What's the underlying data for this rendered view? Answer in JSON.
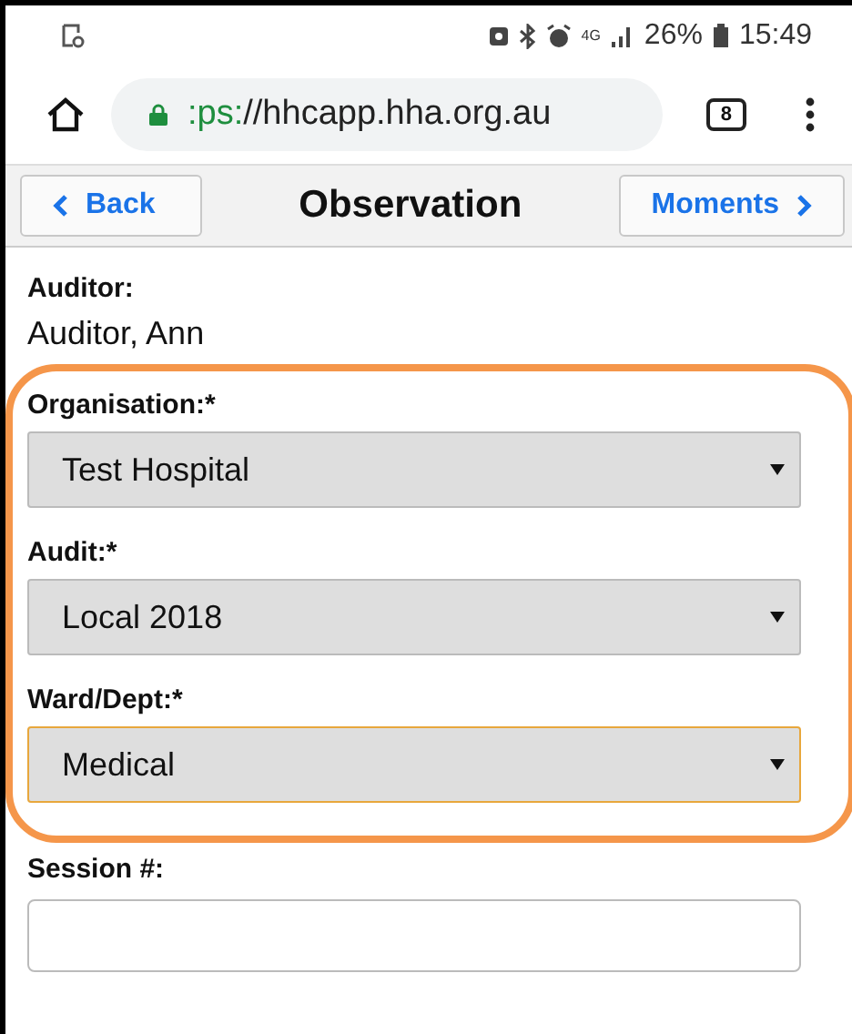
{
  "status_bar": {
    "battery": "26%",
    "time": "15:49",
    "network": "4G"
  },
  "browser": {
    "url_scheme": ":ps:",
    "url_rest": "//hhcapp.hha.org.au",
    "tab_count": "8"
  },
  "header": {
    "back": "Back",
    "title": "Observation",
    "next": "Moments"
  },
  "auditor": {
    "label": "Auditor:",
    "value": "Auditor, Ann"
  },
  "highlight_outline": true,
  "selects": [
    {
      "label": "Organisation:*",
      "value": "Test Hospital",
      "focused": false
    },
    {
      "label": "Audit:*",
      "value": "Local 2018",
      "focused": false
    },
    {
      "label": "Ward/Dept:*",
      "value": "Medical",
      "focused": true
    }
  ],
  "session": {
    "label": "Session #:"
  }
}
